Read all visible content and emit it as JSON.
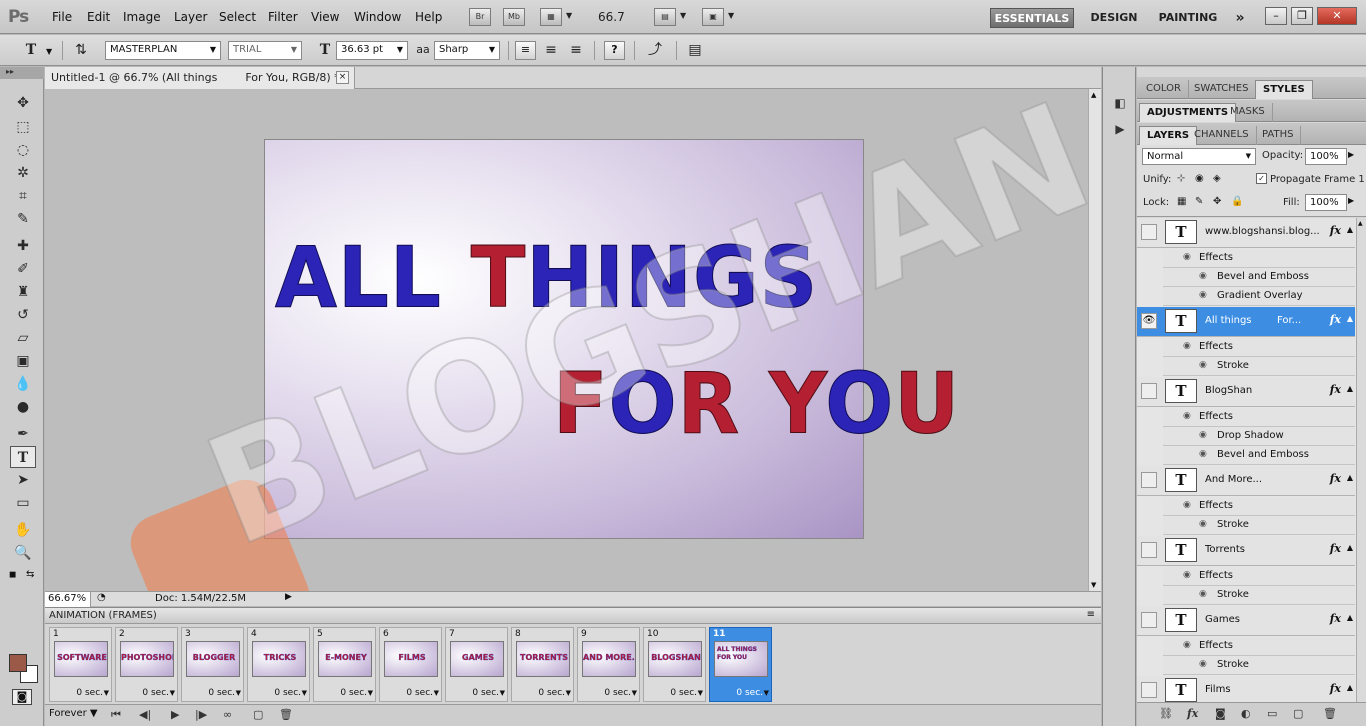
{
  "app": {
    "logo": "Ps",
    "menu": [
      "File",
      "Edit",
      "Image",
      "Layer",
      "Select",
      "Filter",
      "View",
      "Window",
      "Help"
    ],
    "bridge_label": "Br",
    "minibridge_label": "Mb",
    "zoom": "66.7",
    "workspaces": {
      "active": "ESSENTIALS",
      "design": "DESIGN",
      "painting": "PAINTING",
      "more": "»"
    }
  },
  "options": {
    "tool_glyph": "T",
    "font_family": "MASTERPLAN",
    "font_style": "TRIAL",
    "font_size": "36.63 pt",
    "aa_label": "a",
    "antialias": "Sharp",
    "help": "?"
  },
  "document": {
    "tab_title": "Untitled-1 @ 66.7% (All things        For You, RGB/8) *",
    "close": "×",
    "canvas": {
      "line1": [
        {
          "text": "ALL ",
          "color": "blue"
        },
        {
          "text": "T",
          "color": "red"
        },
        {
          "text": "HINGS",
          "color": "blue"
        }
      ],
      "line2": [
        {
          "text": "F",
          "color": "red"
        },
        {
          "text": "O",
          "color": "blue"
        },
        {
          "text": "R ",
          "color": "red"
        },
        {
          "text": "Y",
          "color": "red"
        },
        {
          "text": "O",
          "color": "blue"
        },
        {
          "text": "U",
          "color": "red"
        }
      ],
      "watermark": "BLOGSHAN"
    },
    "status_zoom": "66.67%",
    "status_doc": "Doc: 1.54M/22.5M"
  },
  "animation": {
    "title": "ANIMATION (FRAMES)",
    "frames": [
      {
        "num": "1",
        "label": "SOFTWARE",
        "delay": "0 sec."
      },
      {
        "num": "2",
        "label": "PHOTOSHOP",
        "delay": "0 sec."
      },
      {
        "num": "3",
        "label": "BLOGGER",
        "delay": "0 sec."
      },
      {
        "num": "4",
        "label": "TRICKS",
        "delay": "0 sec."
      },
      {
        "num": "5",
        "label": "E-MONEY",
        "delay": "0 sec."
      },
      {
        "num": "6",
        "label": "FILMS",
        "delay": "0 sec."
      },
      {
        "num": "7",
        "label": "GAMES",
        "delay": "0 sec."
      },
      {
        "num": "8",
        "label": "TORRENTS",
        "delay": "0 sec."
      },
      {
        "num": "9",
        "label": "AND MORE...",
        "delay": "0 sec."
      },
      {
        "num": "10",
        "label": "BLOGSHAN",
        "delay": "0 sec."
      },
      {
        "num": "11",
        "label": "ALL THINGS FOR YOU",
        "delay": "0 sec."
      }
    ],
    "loop": "Forever"
  },
  "panels": {
    "row1": [
      "COLOR",
      "SWATCHES",
      "STYLES"
    ],
    "row2": [
      "ADJUSTMENTS",
      "MASKS"
    ],
    "row3": [
      "LAYERS",
      "CHANNELS",
      "PATHS"
    ],
    "blend_mode": "Normal",
    "opacity_label": "Opacity:",
    "opacity": "100%",
    "unify_label": "Unify:",
    "propagate_label": "Propagate Frame 1",
    "lock_label": "Lock:",
    "fill_label": "Fill:",
    "fill": "100%",
    "effects_label": "Effects",
    "layers": [
      {
        "name": "www.blogshansi.blog...",
        "eye": false,
        "effects": [
          "Bevel and Emboss",
          "Gradient Overlay"
        ]
      },
      {
        "name": "All things        For...",
        "eye": true,
        "active": true,
        "effects": [
          "Stroke"
        ]
      },
      {
        "name": "BlogShan",
        "eye": false,
        "effects": [
          "Drop Shadow",
          "Bevel and Emboss"
        ]
      },
      {
        "name": "And More...",
        "eye": false,
        "effects": [
          "Stroke"
        ]
      },
      {
        "name": "Torrents",
        "eye": false,
        "effects": [
          "Stroke"
        ]
      },
      {
        "name": "Games",
        "eye": false,
        "effects": [
          "Stroke"
        ]
      },
      {
        "name": "Films",
        "eye": false,
        "effects": []
      }
    ]
  },
  "colors": {
    "accent": "#3d8ee3",
    "foreground": "#9b5a47",
    "background": "#ffffff",
    "text_blue": "#2b24b6",
    "text_red": "#b41f31"
  }
}
